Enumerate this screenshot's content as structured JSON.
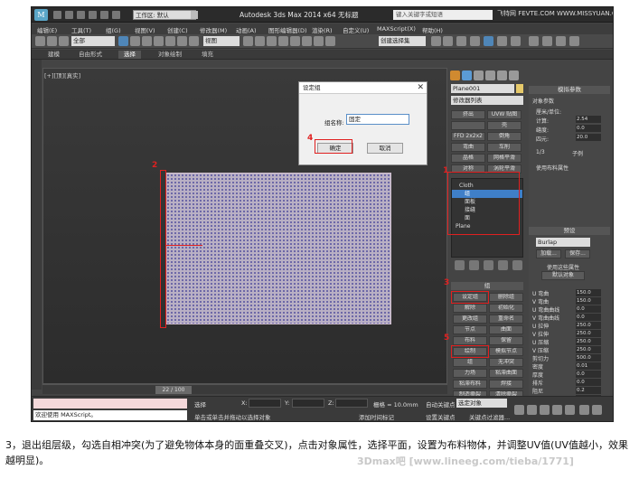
{
  "title_bar": {
    "workspace": "工作区: 默认",
    "app_title": "Autodesk 3ds Max  2014 x64    无标题",
    "search_placeholder": "键入关键字或短语",
    "watermark": "飞特网 FEVTE.COM  WWW.MISSYUAN.COM"
  },
  "menu": [
    "编辑(E)",
    "工具(T)",
    "组(G)",
    "视图(V)",
    "创建(C)",
    "修改器(M)",
    "动画(A)",
    "图形编辑器(D)",
    "渲染(R)",
    "自定义(U)",
    "MAXScript(X)",
    "帮助(H)"
  ],
  "toolbar": {
    "selection_filter": "全部",
    "ref_coord": "视图",
    "named_sel": "创建选择集"
  },
  "ribbon_tabs": [
    {
      "label": "建模",
      "active": false
    },
    {
      "label": "自由形式",
      "active": false
    },
    {
      "label": "选择",
      "active": true
    },
    {
      "label": "对象绘制",
      "active": false
    },
    {
      "label": "填充",
      "active": false
    }
  ],
  "viewport": {
    "label": "[+][顶][真实]"
  },
  "dialog": {
    "title": "设定组",
    "group_label": "组名称:",
    "group_value": "固定",
    "ok": "确定",
    "cancel": "取消"
  },
  "annotations": {
    "n1": "1",
    "n2": "2",
    "n3": "3",
    "n4": "4",
    "n5": "5"
  },
  "command_panel": {
    "object_name": "Plane001",
    "modifier_list": "修改器列表",
    "mod_buttons": [
      "挤出",
      "UVW 贴图",
      "",
      "壳",
      "FFD 2x2x2",
      "倒角",
      "弯曲",
      "车削",
      "晶格",
      "网格平滑",
      "对称",
      "涡轮平滑"
    ],
    "stack": [
      {
        "label": "Cloth",
        "sel": false
      },
      {
        "label": "组",
        "sel": true
      },
      {
        "label": "面板",
        "sel": false
      },
      {
        "label": "接缝",
        "sel": false
      },
      {
        "label": "面",
        "sel": false
      },
      {
        "label": "Plane",
        "sel": false
      }
    ],
    "group_rollout_title": "组",
    "group_buttons": [
      "设定组",
      "删除组",
      "解除",
      "初始化",
      "更改组",
      "重命名",
      "节点",
      "曲面",
      "布料",
      "保留",
      "绘制",
      "模拟节点",
      "组",
      "无冲突",
      "力场",
      "粘滞曲面",
      "粘滞布料",
      "焊接",
      "制造撕裂",
      "清除撕裂"
    ]
  },
  "props": {
    "object_params": "模拟参数",
    "cloth_params_title": "对象参数",
    "labels": [
      "厘米/单位:",
      "计算:",
      "缝度:",
      "四元:"
    ],
    "sim_values": [
      "2.54",
      "0.0",
      "20.0"
    ],
    "sub_options": [
      "1/3",
      "子例",
      "使用布料属性"
    ],
    "preset_title": "预设",
    "preset_value": "Burlap",
    "load": "加载...",
    "save": "保存...",
    "use_props": "使用这些属性",
    "default_obj": "默认对象",
    "uv_params": [
      {
        "label": "U 弯曲",
        "value": "150.0"
      },
      {
        "label": "V 弯曲",
        "value": "150.0"
      },
      {
        "label": "U 弯曲曲线",
        "value": "0.0"
      },
      {
        "label": "V 弯曲曲线",
        "value": "0.0"
      },
      {
        "label": "U 拉伸",
        "value": "250.0"
      },
      {
        "label": "V 拉伸",
        "value": "250.0"
      },
      {
        "label": "U 压缩",
        "value": "250.0"
      },
      {
        "label": "V 压缩",
        "value": "250.0"
      },
      {
        "label": "剪切力",
        "value": "500.0"
      },
      {
        "label": "密度",
        "value": "0.01"
      },
      {
        "label": "厚度",
        "value": "0.0"
      },
      {
        "label": "排斥",
        "value": "0.0"
      },
      {
        "label": "阻尼",
        "value": "0.2"
      },
      {
        "label": "空气阻力",
        "value": "0.02"
      }
    ]
  },
  "timeline": {
    "frame": "22 / 100"
  },
  "status": {
    "script_prompt": "欢迎使用 MAXScript。",
    "select_label": "选择",
    "x_label": "X:",
    "y_label": "Y:",
    "z_label": "Z:",
    "grid": "栅格 = 10.0mm",
    "hint": "单击或单击并拖动以选择对象",
    "add_time_tag": "添加时间标记",
    "auto_key": "自动关键点",
    "set_key": "设置关键点",
    "key_filter": "选定对象",
    "key_filters_btn": "关键点过滤器..."
  },
  "caption": "3，退出组层级，勾选自相冲突(为了避免物体本身的面重叠交叉)，点击对象属性，选择平面，设置为布料物体，并调整UV值(UV值越小，效果越明显)。",
  "bottom_watermark": "3Dmax吧  [www.lineeg.com/tieba/1771]",
  "colors": {
    "highlight": "#e02020",
    "selection_blue": "#3f7fc8",
    "ui_dark": "#444444"
  }
}
